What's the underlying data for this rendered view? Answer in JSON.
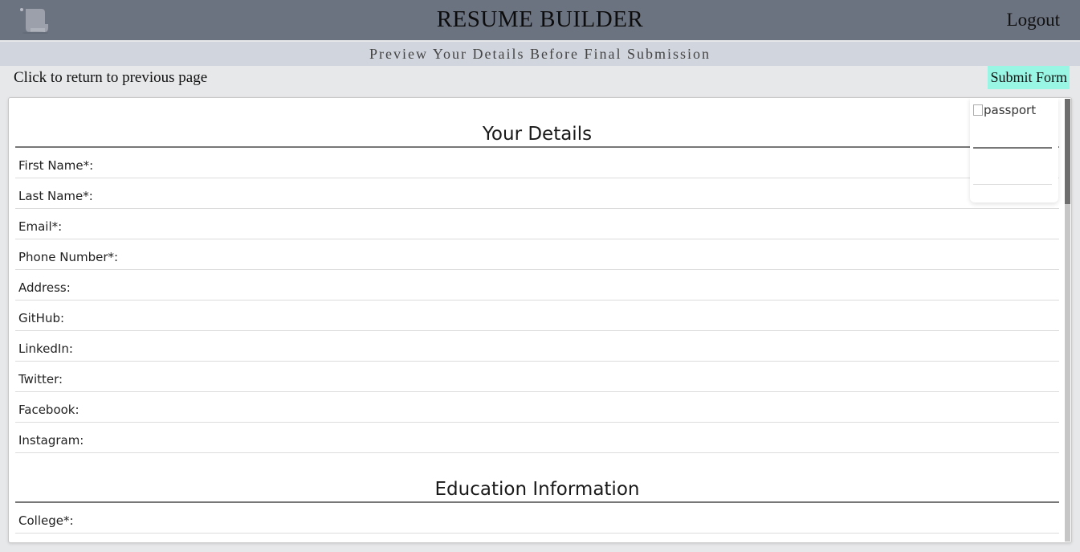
{
  "header": {
    "title": "RESUME BUILDER",
    "logout_label": "Logout",
    "logo_icon": "scroll-icon"
  },
  "subheader": {
    "text": "Preview Your Details Before Final Submission"
  },
  "actions": {
    "back_label": "Click to return to previous page",
    "submit_label": "Submit Form"
  },
  "passport": {
    "alt_text": "passport"
  },
  "sections": {
    "details": {
      "title": "Your Details",
      "fields": [
        "First Name*:",
        "Last Name*:",
        "Email*:",
        "Phone Number*:",
        "Address:",
        "GitHub:",
        "LinkedIn:",
        "Twitter:",
        "Facebook:",
        "Instagram:"
      ]
    },
    "education": {
      "title": "Education Information",
      "fields": [
        "College*:"
      ]
    }
  },
  "colors": {
    "topbar": "#6b7280",
    "subbar": "#d1d5de",
    "submit_button": "#99f6e4",
    "background": "#e7e8ea"
  }
}
